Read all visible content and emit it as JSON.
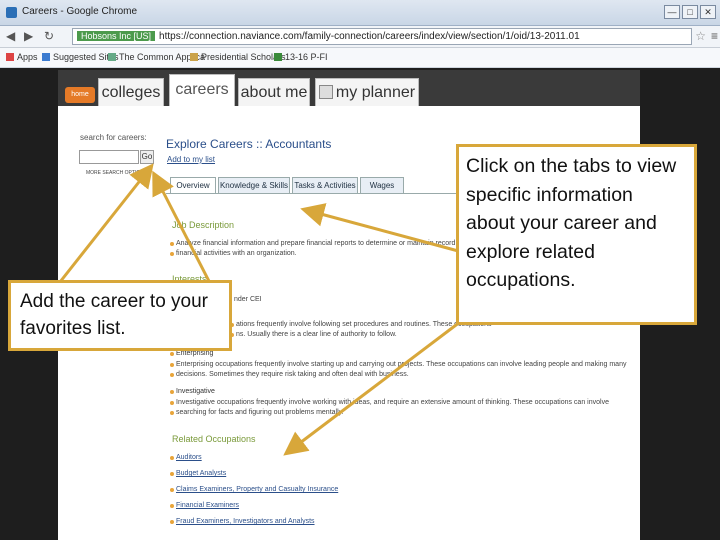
{
  "browser": {
    "title": "Careers - Google Chrome",
    "cert_label": "Hobsons Inc [US]",
    "url": "https://connection.naviance.com/family-connection/careers/index/view/section/1/oid/13-2011.01",
    "window_buttons": [
      "—",
      "□",
      "✕"
    ],
    "bookmarks": [
      "Apps",
      "Suggested Sites",
      "The Common Applica",
      "Presidential Scholars",
      "13-16 P-FI"
    ]
  },
  "site": {
    "home_label": "home",
    "tabs": [
      "colleges",
      "careers",
      "about me",
      "my planner"
    ],
    "active_tab": "careers"
  },
  "sidebar": {
    "search_label": "search for careers:",
    "go_label": "Go",
    "more_search": "MORE SEARCH OPTIONS"
  },
  "main": {
    "title": "Explore Careers :: Accountants",
    "add_favorites": "Add to my list",
    "tabs": [
      "Overview",
      "Knowledge & Skills",
      "Tasks & Activities",
      "Wages"
    ],
    "job_description_heading": "Job Description",
    "job_description": "Analyze financial information and prepare financial reports to determine or maintain record",
    "job_description_2": "financial activities with an organization.",
    "interests_heading": "Interests",
    "interest_code": "nder CEI",
    "conventional_text": "ations frequently involve following set procedures and routines. These occupations",
    "conventional_text_2": "ns. Usually there is a clear line of authority to follow.",
    "enterprising_label": "Enterprising",
    "enterprising_text": "Enterprising occupations frequently involve starting up and carrying out projects. These occupations can involve leading people and making many",
    "enterprising_text_2": "decisions. Sometimes they require risk taking and often deal with business.",
    "investigative_label": "Investigative",
    "investigative_text": "Investigative occupations frequently involve working with ideas, and require an extensive amount of thinking. These occupations can involve",
    "investigative_text_2": "searching for facts and figuring out problems mentally.",
    "related_heading": "Related Occupations",
    "related": [
      "Auditors",
      "Budget Analysts",
      "Claims Examiners, Property and Casualty Insurance",
      "Financial Examiners",
      "Fraud Examiners, Investigators and Analysts"
    ]
  },
  "callouts": {
    "left": "Add the career to your favorites list.",
    "right": "Click on the tabs to view specific information about your career and explore related occupations."
  },
  "colors": {
    "callout_border": "#d8a73a",
    "home_orange": "#e57a27",
    "link_blue": "#2b4f8a"
  }
}
